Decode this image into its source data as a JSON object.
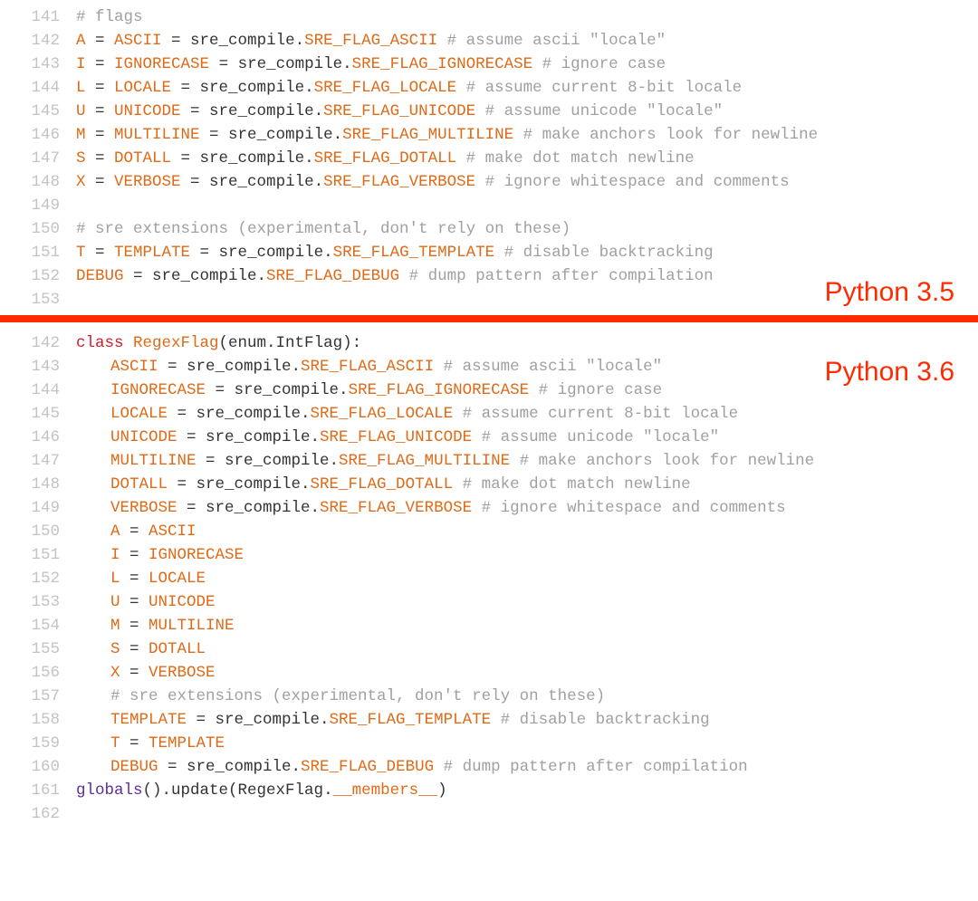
{
  "labels": {
    "v35": "Python 3.5",
    "v36": "Python 3.6"
  },
  "top": {
    "lines": [
      {
        "ln": "141",
        "indent": 0,
        "tokens": [
          {
            "cls": "com",
            "t": "# flags"
          }
        ]
      },
      {
        "ln": "142",
        "indent": 0,
        "tokens": [
          {
            "cls": "attr",
            "t": "A"
          },
          {
            "cls": "obj",
            "t": " = "
          },
          {
            "cls": "attr",
            "t": "ASCII"
          },
          {
            "cls": "obj",
            "t": " = sre_compile."
          },
          {
            "cls": "con",
            "t": "SRE_FLAG_ASCII"
          },
          {
            "cls": "obj",
            "t": " "
          },
          {
            "cls": "com",
            "t": "# assume ascii \"locale\""
          }
        ]
      },
      {
        "ln": "143",
        "indent": 0,
        "tokens": [
          {
            "cls": "attr",
            "t": "I"
          },
          {
            "cls": "obj",
            "t": " = "
          },
          {
            "cls": "attr",
            "t": "IGNORECASE"
          },
          {
            "cls": "obj",
            "t": " = sre_compile."
          },
          {
            "cls": "con",
            "t": "SRE_FLAG_IGNORECASE"
          },
          {
            "cls": "obj",
            "t": " "
          },
          {
            "cls": "com",
            "t": "# ignore case"
          }
        ]
      },
      {
        "ln": "144",
        "indent": 0,
        "tokens": [
          {
            "cls": "attr",
            "t": "L"
          },
          {
            "cls": "obj",
            "t": " = "
          },
          {
            "cls": "attr",
            "t": "LOCALE"
          },
          {
            "cls": "obj",
            "t": " = sre_compile."
          },
          {
            "cls": "con",
            "t": "SRE_FLAG_LOCALE"
          },
          {
            "cls": "obj",
            "t": " "
          },
          {
            "cls": "com",
            "t": "# assume current 8-bit locale"
          }
        ]
      },
      {
        "ln": "145",
        "indent": 0,
        "tokens": [
          {
            "cls": "attr",
            "t": "U"
          },
          {
            "cls": "obj",
            "t": " = "
          },
          {
            "cls": "attr",
            "t": "UNICODE"
          },
          {
            "cls": "obj",
            "t": " = sre_compile."
          },
          {
            "cls": "con",
            "t": "SRE_FLAG_UNICODE"
          },
          {
            "cls": "obj",
            "t": " "
          },
          {
            "cls": "com",
            "t": "# assume unicode \"locale\""
          }
        ]
      },
      {
        "ln": "146",
        "indent": 0,
        "tokens": [
          {
            "cls": "attr",
            "t": "M"
          },
          {
            "cls": "obj",
            "t": " = "
          },
          {
            "cls": "attr",
            "t": "MULTILINE"
          },
          {
            "cls": "obj",
            "t": " = sre_compile."
          },
          {
            "cls": "con",
            "t": "SRE_FLAG_MULTILINE"
          },
          {
            "cls": "obj",
            "t": " "
          },
          {
            "cls": "com",
            "t": "# make anchors look for newline"
          }
        ]
      },
      {
        "ln": "147",
        "indent": 0,
        "tokens": [
          {
            "cls": "attr",
            "t": "S"
          },
          {
            "cls": "obj",
            "t": " = "
          },
          {
            "cls": "attr",
            "t": "DOTALL"
          },
          {
            "cls": "obj",
            "t": " = sre_compile."
          },
          {
            "cls": "con",
            "t": "SRE_FLAG_DOTALL"
          },
          {
            "cls": "obj",
            "t": " "
          },
          {
            "cls": "com",
            "t": "# make dot match newline"
          }
        ]
      },
      {
        "ln": "148",
        "indent": 0,
        "tokens": [
          {
            "cls": "attr",
            "t": "X"
          },
          {
            "cls": "obj",
            "t": " = "
          },
          {
            "cls": "attr",
            "t": "VERBOSE"
          },
          {
            "cls": "obj",
            "t": " = sre_compile."
          },
          {
            "cls": "con",
            "t": "SRE_FLAG_VERBOSE"
          },
          {
            "cls": "obj",
            "t": " "
          },
          {
            "cls": "com",
            "t": "# ignore whitespace and comments"
          }
        ]
      },
      {
        "ln": "149",
        "indent": 0,
        "tokens": [
          {
            "cls": "obj",
            "t": ""
          }
        ]
      },
      {
        "ln": "150",
        "indent": 0,
        "tokens": [
          {
            "cls": "com",
            "t": "# sre extensions (experimental, don't rely on these)"
          }
        ]
      },
      {
        "ln": "151",
        "indent": 0,
        "tokens": [
          {
            "cls": "attr",
            "t": "T"
          },
          {
            "cls": "obj",
            "t": " = "
          },
          {
            "cls": "attr",
            "t": "TEMPLATE"
          },
          {
            "cls": "obj",
            "t": " = sre_compile."
          },
          {
            "cls": "con",
            "t": "SRE_FLAG_TEMPLATE"
          },
          {
            "cls": "obj",
            "t": " "
          },
          {
            "cls": "com",
            "t": "# disable backtracking"
          }
        ]
      },
      {
        "ln": "152",
        "indent": 0,
        "tokens": [
          {
            "cls": "attr",
            "t": "DEBUG"
          },
          {
            "cls": "obj",
            "t": " = sre_compile."
          },
          {
            "cls": "con",
            "t": "SRE_FLAG_DEBUG"
          },
          {
            "cls": "obj",
            "t": " "
          },
          {
            "cls": "com",
            "t": "# dump pattern after compilation"
          }
        ]
      },
      {
        "ln": "153",
        "indent": 0,
        "tokens": [
          {
            "cls": "obj",
            "t": ""
          }
        ]
      }
    ]
  },
  "bottom": {
    "lines": [
      {
        "ln": "142",
        "indent": 0,
        "tokens": [
          {
            "cls": "kw",
            "t": "class"
          },
          {
            "cls": "obj",
            "t": " "
          },
          {
            "cls": "cls",
            "t": "RegexFlag"
          },
          {
            "cls": "obj",
            "t": "(enum.IntFlag):"
          }
        ]
      },
      {
        "ln": "143",
        "indent": 1,
        "tokens": [
          {
            "cls": "attr",
            "t": "ASCII"
          },
          {
            "cls": "obj",
            "t": " = sre_compile."
          },
          {
            "cls": "con",
            "t": "SRE_FLAG_ASCII"
          },
          {
            "cls": "obj",
            "t": " "
          },
          {
            "cls": "com",
            "t": "# assume ascii \"locale\""
          }
        ]
      },
      {
        "ln": "144",
        "indent": 1,
        "tokens": [
          {
            "cls": "attr",
            "t": "IGNORECASE"
          },
          {
            "cls": "obj",
            "t": " = sre_compile."
          },
          {
            "cls": "con",
            "t": "SRE_FLAG_IGNORECASE"
          },
          {
            "cls": "obj",
            "t": " "
          },
          {
            "cls": "com",
            "t": "# ignore case"
          }
        ]
      },
      {
        "ln": "145",
        "indent": 1,
        "tokens": [
          {
            "cls": "attr",
            "t": "LOCALE"
          },
          {
            "cls": "obj",
            "t": " = sre_compile."
          },
          {
            "cls": "con",
            "t": "SRE_FLAG_LOCALE"
          },
          {
            "cls": "obj",
            "t": " "
          },
          {
            "cls": "com",
            "t": "# assume current 8-bit locale"
          }
        ]
      },
      {
        "ln": "146",
        "indent": 1,
        "tokens": [
          {
            "cls": "attr",
            "t": "UNICODE"
          },
          {
            "cls": "obj",
            "t": " = sre_compile."
          },
          {
            "cls": "con",
            "t": "SRE_FLAG_UNICODE"
          },
          {
            "cls": "obj",
            "t": " "
          },
          {
            "cls": "com",
            "t": "# assume unicode \"locale\""
          }
        ]
      },
      {
        "ln": "147",
        "indent": 1,
        "tokens": [
          {
            "cls": "attr",
            "t": "MULTILINE"
          },
          {
            "cls": "obj",
            "t": " = sre_compile."
          },
          {
            "cls": "con",
            "t": "SRE_FLAG_MULTILINE"
          },
          {
            "cls": "obj",
            "t": " "
          },
          {
            "cls": "com",
            "t": "# make anchors look for newline"
          }
        ]
      },
      {
        "ln": "148",
        "indent": 1,
        "tokens": [
          {
            "cls": "attr",
            "t": "DOTALL"
          },
          {
            "cls": "obj",
            "t": " = sre_compile."
          },
          {
            "cls": "con",
            "t": "SRE_FLAG_DOTALL"
          },
          {
            "cls": "obj",
            "t": " "
          },
          {
            "cls": "com",
            "t": "# make dot match newline"
          }
        ]
      },
      {
        "ln": "149",
        "indent": 1,
        "tokens": [
          {
            "cls": "attr",
            "t": "VERBOSE"
          },
          {
            "cls": "obj",
            "t": " = sre_compile."
          },
          {
            "cls": "con",
            "t": "SRE_FLAG_VERBOSE"
          },
          {
            "cls": "obj",
            "t": " "
          },
          {
            "cls": "com",
            "t": "# ignore whitespace and comments"
          }
        ]
      },
      {
        "ln": "150",
        "indent": 1,
        "tokens": [
          {
            "cls": "attr",
            "t": "A"
          },
          {
            "cls": "obj",
            "t": " = "
          },
          {
            "cls": "attr",
            "t": "ASCII"
          }
        ]
      },
      {
        "ln": "151",
        "indent": 1,
        "tokens": [
          {
            "cls": "attr",
            "t": "I"
          },
          {
            "cls": "obj",
            "t": " = "
          },
          {
            "cls": "attr",
            "t": "IGNORECASE"
          }
        ]
      },
      {
        "ln": "152",
        "indent": 1,
        "tokens": [
          {
            "cls": "attr",
            "t": "L"
          },
          {
            "cls": "obj",
            "t": " = "
          },
          {
            "cls": "attr",
            "t": "LOCALE"
          }
        ]
      },
      {
        "ln": "153",
        "indent": 1,
        "tokens": [
          {
            "cls": "attr",
            "t": "U"
          },
          {
            "cls": "obj",
            "t": " = "
          },
          {
            "cls": "attr",
            "t": "UNICODE"
          }
        ]
      },
      {
        "ln": "154",
        "indent": 1,
        "tokens": [
          {
            "cls": "attr",
            "t": "M"
          },
          {
            "cls": "obj",
            "t": " = "
          },
          {
            "cls": "attr",
            "t": "MULTILINE"
          }
        ]
      },
      {
        "ln": "155",
        "indent": 1,
        "tokens": [
          {
            "cls": "attr",
            "t": "S"
          },
          {
            "cls": "obj",
            "t": " = "
          },
          {
            "cls": "attr",
            "t": "DOTALL"
          }
        ]
      },
      {
        "ln": "156",
        "indent": 1,
        "tokens": [
          {
            "cls": "attr",
            "t": "X"
          },
          {
            "cls": "obj",
            "t": " = "
          },
          {
            "cls": "attr",
            "t": "VERBOSE"
          }
        ]
      },
      {
        "ln": "157",
        "indent": 1,
        "tokens": [
          {
            "cls": "com",
            "t": "# sre extensions (experimental, don't rely on these)"
          }
        ]
      },
      {
        "ln": "158",
        "indent": 1,
        "tokens": [
          {
            "cls": "attr",
            "t": "TEMPLATE"
          },
          {
            "cls": "obj",
            "t": " = sre_compile."
          },
          {
            "cls": "con",
            "t": "SRE_FLAG_TEMPLATE"
          },
          {
            "cls": "obj",
            "t": " "
          },
          {
            "cls": "com",
            "t": "# disable backtracking"
          }
        ]
      },
      {
        "ln": "159",
        "indent": 1,
        "tokens": [
          {
            "cls": "attr",
            "t": "T"
          },
          {
            "cls": "obj",
            "t": " = "
          },
          {
            "cls": "attr",
            "t": "TEMPLATE"
          }
        ]
      },
      {
        "ln": "160",
        "indent": 1,
        "tokens": [
          {
            "cls": "attr",
            "t": "DEBUG"
          },
          {
            "cls": "obj",
            "t": " = sre_compile."
          },
          {
            "cls": "con",
            "t": "SRE_FLAG_DEBUG"
          },
          {
            "cls": "obj",
            "t": " "
          },
          {
            "cls": "com",
            "t": "# dump pattern after compilation"
          }
        ]
      },
      {
        "ln": "161",
        "indent": 0,
        "tokens": [
          {
            "cls": "func",
            "t": "globals"
          },
          {
            "cls": "obj",
            "t": "().update("
          },
          {
            "cls": "obj",
            "t": "RegexFlag"
          },
          {
            "cls": "obj",
            "t": "."
          },
          {
            "cls": "attr",
            "t": "__members__"
          },
          {
            "cls": "obj",
            "t": ")"
          }
        ]
      },
      {
        "ln": "162",
        "indent": 0,
        "tokens": [
          {
            "cls": "obj",
            "t": ""
          }
        ]
      }
    ]
  }
}
